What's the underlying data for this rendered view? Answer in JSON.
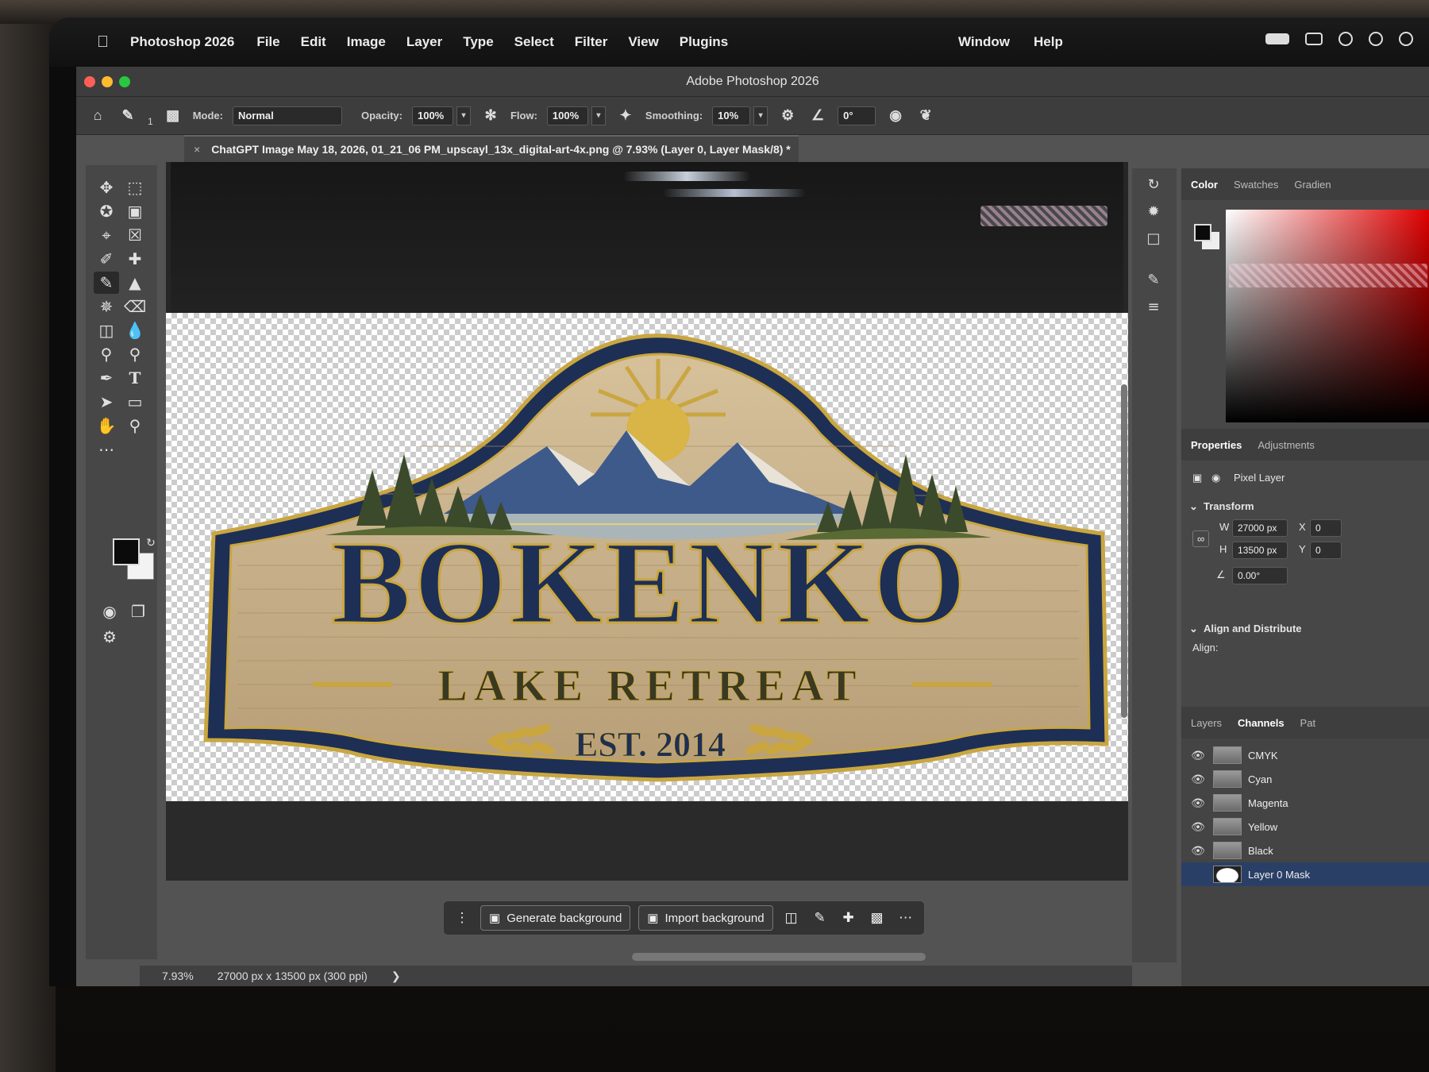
{
  "menubar": {
    "app_name": "Photoshop 2026",
    "items": [
      "File",
      "Edit",
      "Image",
      "Layer",
      "Type",
      "Select",
      "Filter",
      "View",
      "Plugins"
    ],
    "right_items": [
      "Window",
      "Help"
    ]
  },
  "window": {
    "title": "Adobe Photoshop 2026"
  },
  "options": {
    "brush_size": "1",
    "mode_label": "Mode:",
    "mode_value": "Normal",
    "opacity_label": "Opacity:",
    "opacity_value": "100%",
    "flow_label": "Flow:",
    "flow_value": "100%",
    "smoothing_label": "Smoothing:",
    "smoothing_value": "10%",
    "angle_value": "0°"
  },
  "document": {
    "tab_title": "ChatGPT Image May 18, 2026, 01_21_06 PM_upscayl_13x_digital-art-4x.png @ 7.93% (Layer 0, Layer Mask/8) *"
  },
  "artwork": {
    "title": "BOKENKO",
    "subtitle": "LAKE RETREAT",
    "established": "EST. 2014",
    "colors": {
      "wood": "#c9b08a",
      "navy": "#1e2f55",
      "gold": "#c9a640"
    }
  },
  "taskbar": {
    "generate_label": "Generate background",
    "import_label": "Import background"
  },
  "status": {
    "zoom": "7.93%",
    "doc_info": "27000 px x 13500 px (300 ppi)"
  },
  "color_panel": {
    "tabs": [
      "Color",
      "Swatches",
      "Gradien"
    ]
  },
  "properties": {
    "tabs": [
      "Properties",
      "Adjustments"
    ],
    "layer_type": "Pixel Layer",
    "transform_label": "Transform",
    "w_label": "W",
    "w_value": "27000 px",
    "h_label": "H",
    "h_value": "13500 px",
    "x_label": "X",
    "x_value": "0",
    "y_label": "Y",
    "y_value": "0",
    "angle_value": "0.00°",
    "align_section": "Align and Distribute",
    "align_label": "Align:"
  },
  "layers_panel": {
    "tabs": [
      "Layers",
      "Channels",
      "Pat"
    ],
    "channels": [
      "CMYK",
      "Cyan",
      "Magenta",
      "Yellow",
      "Black",
      "Layer 0 Mask"
    ]
  }
}
